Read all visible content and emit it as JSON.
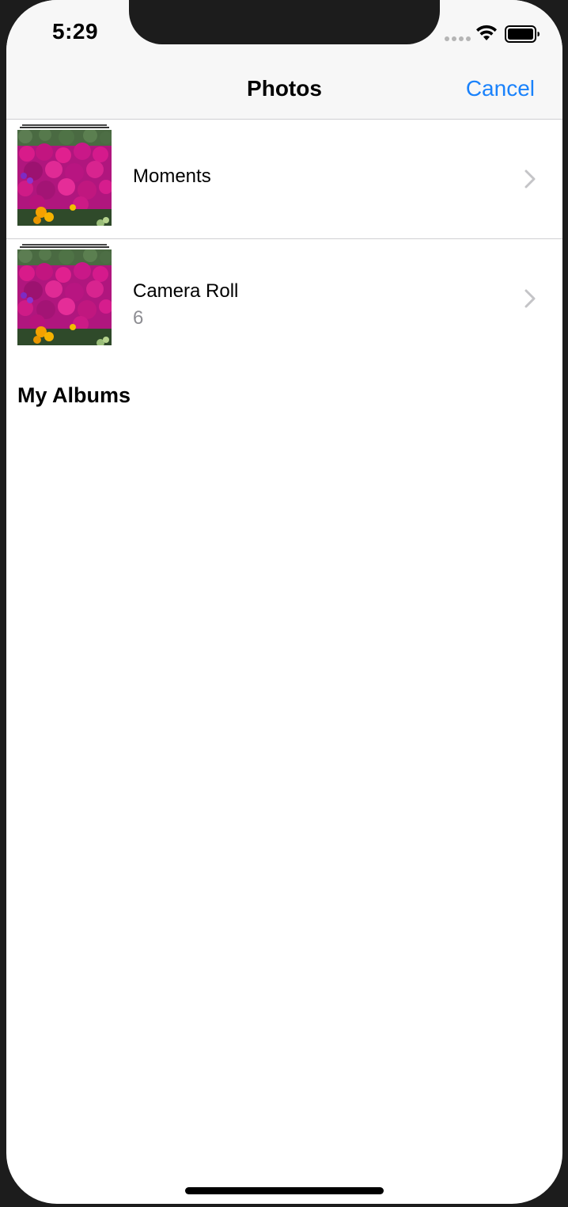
{
  "status_bar": {
    "time": "5:29",
    "signal_icon": "cellular-signal-icon",
    "wifi_icon": "wifi-icon",
    "battery_icon": "battery-icon"
  },
  "nav_bar": {
    "title": "Photos",
    "cancel_label": "Cancel",
    "accent_color": "#1a82fb"
  },
  "albums": [
    {
      "title": "Moments",
      "count": "",
      "thumbnail_icon": "flower-photo-thumbnail",
      "chevron_icon": "chevron-right-icon"
    },
    {
      "title": "Camera Roll",
      "count": "6",
      "thumbnail_icon": "flower-photo-thumbnail",
      "chevron_icon": "chevron-right-icon"
    }
  ],
  "section": {
    "my_albums_header": "My Albums"
  }
}
